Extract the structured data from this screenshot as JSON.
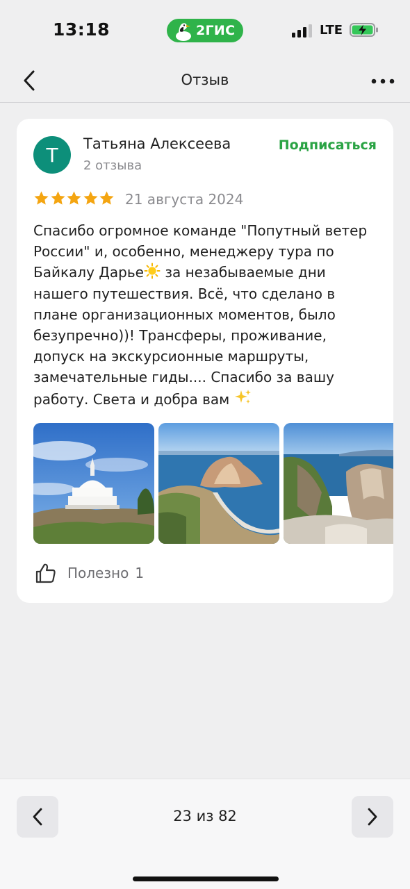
{
  "status_bar": {
    "time": "13:18",
    "app_badge": "2ГИС",
    "network": "LTE",
    "icons": [
      "goose-logo-icon",
      "signal-icon",
      "battery-charging-icon"
    ]
  },
  "header": {
    "title": "Отзыв",
    "back_icon": "chevron-left-icon",
    "more_icon": "more-horizontal-icon"
  },
  "review": {
    "avatar_letter": "Т",
    "avatar_color": "#0d8f7a",
    "author": "Татьяна Алексеева",
    "reviews_count": "2 отзыва",
    "subscribe_label": "Подписаться",
    "rating": 5,
    "rating_max": 5,
    "date": "21 августа 2024",
    "text_part1": "Спасибо огромное команде \"Попутный ветер России\" и, особенно, менеджеру тура по Байкалу Дарье",
    "emoji_sun": "sun-emoji",
    "text_part2": " за незабываемые дни нашего путешествия. Всё, что сделано в плане организационных моментов, было безупречно))! Трансферы, проживание, допуск на экскурсионные маршруты, замечательные гиды.... Спасибо за вашу работу. Света и добра вам ",
    "emoji_sparkles": "sparkles-emoji",
    "photos": [
      "stupa-photo",
      "cape-photo",
      "cliffs-photo"
    ],
    "helpful_label": "Полезно",
    "helpful_count": "1"
  },
  "bottom": {
    "pager": "23 из 82",
    "prev_icon": "chevron-left-icon",
    "next_icon": "chevron-right-icon"
  },
  "colors": {
    "accent_green": "#2aa344",
    "brand_green": "#2fb34a",
    "star_gold": "#f4a511",
    "background": "#efeff0"
  }
}
